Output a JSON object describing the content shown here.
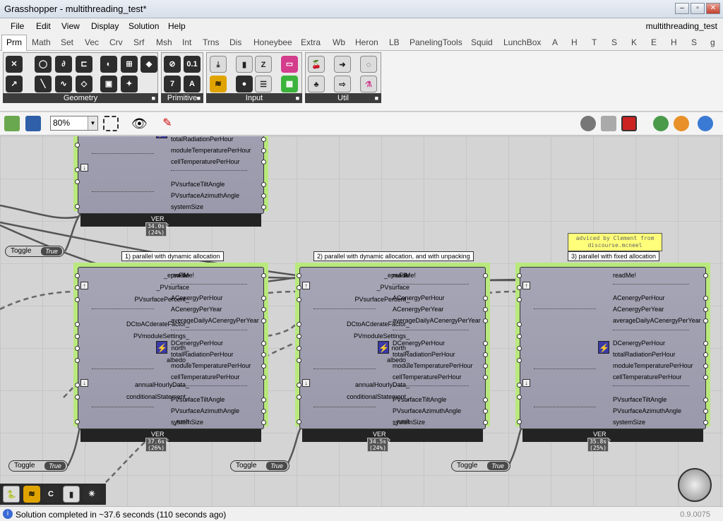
{
  "window": {
    "title": "Grasshopper - multithreading_test*",
    "doc_name": "multithreading_test"
  },
  "menu": [
    "File",
    "Edit",
    "View",
    "Display",
    "Solution",
    "Help"
  ],
  "tabs": [
    "Prm",
    "Math",
    "Set",
    "Vec",
    "Crv",
    "Srf",
    "Msh",
    "Int",
    "Trns",
    "Dis",
    "Honeybee",
    "Extra",
    "Wb",
    "Heron",
    "LB",
    "PanelingTools",
    "Squid",
    "LunchBox",
    "A",
    "H",
    "T",
    "S",
    "K",
    "E",
    "H",
    "S",
    "g"
  ],
  "ribbon_groups": [
    "Geometry",
    "Primitive",
    "Input",
    "Util"
  ],
  "primitive_icons": [
    "7",
    "0.1",
    "A"
  ],
  "zoom": "80%",
  "status": {
    "message": "Solution completed in ~37.6 seconds (110 seconds ago)",
    "version": "0.9.0075"
  },
  "inputs": [
    "_epwFile",
    "_PVsurface",
    "PVsurfacePercent_",
    "DCtoACderateFactor_",
    "PVmoduleSettings_",
    "north_",
    "albedo_",
    "annualHourlyData_",
    "conditionalStatement_",
    "_runIt"
  ],
  "outputs": [
    "readMe!",
    "ACenergyPerHour",
    "ACenergyPerYear",
    "averageDailyACenergyPerYear",
    "DCenergyPerHour",
    "totalRadiationPerHour",
    "moduleTemperaturePerHour",
    "cellTemperaturePerHour",
    "PVsurfaceTiltAngle",
    "PVsurfaceAzimuthAngle",
    "systemSize"
  ],
  "components": [
    {
      "header": "",
      "version": "VER 0.0.62",
      "time": "34.0s (24%)",
      "toggle": "True"
    },
    {
      "header": "1) parallel with dynamic allocation",
      "version": "VER 0.0.62",
      "time": "37.6s (26%)",
      "toggle": "True"
    },
    {
      "header": "2) parallel with dynamic allocation, and with unpacking",
      "version": "VER 0.0.62",
      "time": "34.5s (24%)",
      "toggle": "True"
    },
    {
      "header": "3) parallel with fixed allocation",
      "version": "VER 0.0.62",
      "time": "35.8s (25%)",
      "toggle": "True"
    }
  ],
  "toggle_label": "Toggle",
  "note": "adviced by Clement from\ndiscourse.mcneel"
}
